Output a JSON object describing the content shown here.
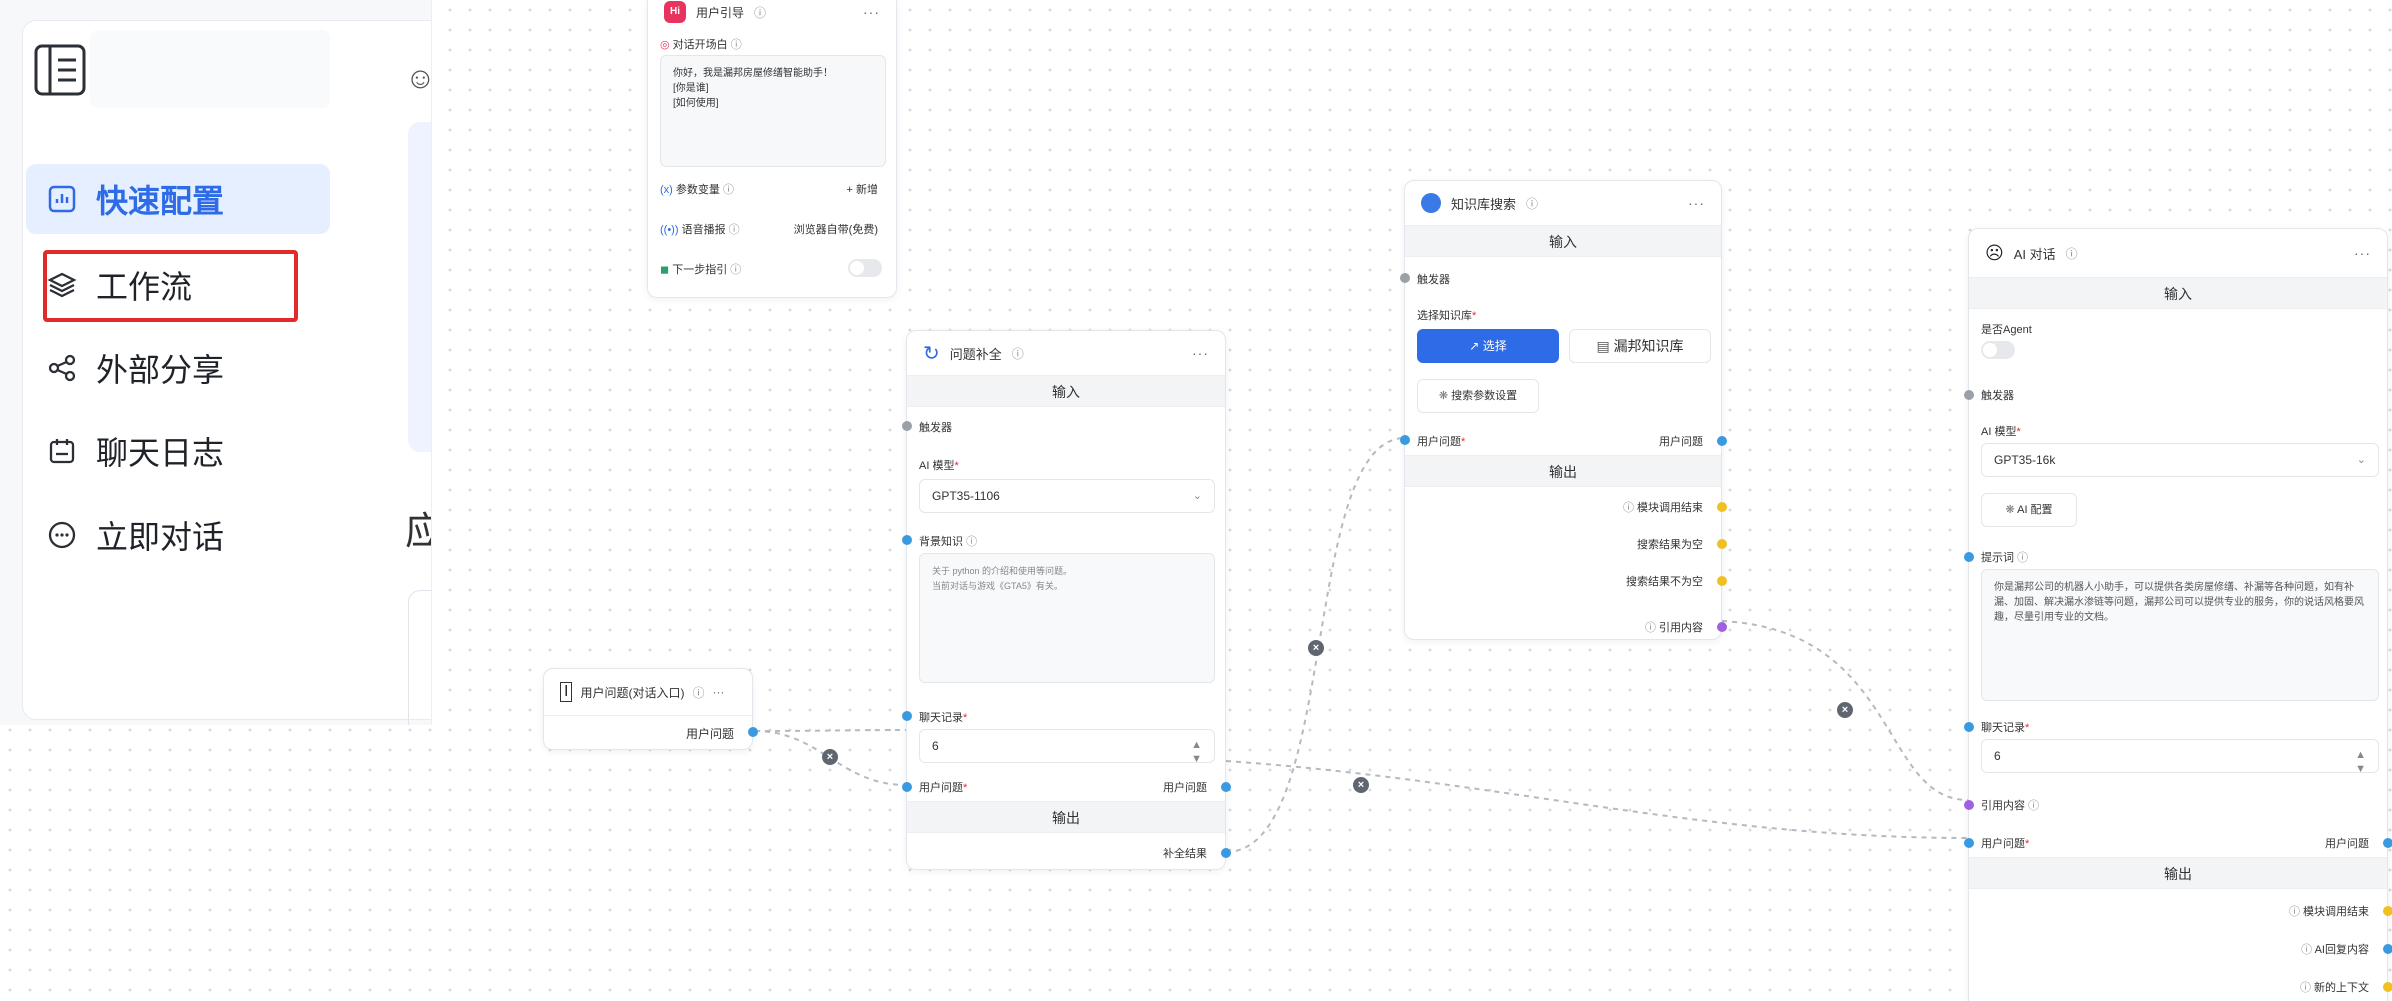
{
  "sidebar": {
    "items": [
      {
        "label": "快速配置",
        "icon": "bar-chart-icon",
        "active": true
      },
      {
        "label": "工作流",
        "icon": "layers-icon",
        "active": false
      },
      {
        "label": "外部分享",
        "icon": "share-icon",
        "active": false
      },
      {
        "label": "聊天日志",
        "icon": "calendar-icon",
        "active": false
      },
      {
        "label": "立即对话",
        "icon": "chat-bubble-icon",
        "active": false
      }
    ],
    "peek_char": "应"
  },
  "nodes": {
    "user_guide": {
      "badge": "Hi",
      "title": "用户引导",
      "opening_label": "对话开场白",
      "opening_text": "你好，我是漏邦房屋修缮智能助手！\n[你是谁]\n[如何使用]",
      "vars_label": "参数变量",
      "vars_action": "+ 新增",
      "voice_label": "语音播报",
      "voice_value": "浏览器自带(免费)",
      "next_label": "下一步指引"
    },
    "entry": {
      "title": "用户问题(对话入口)",
      "output_label": "用户问题"
    },
    "question_completion": {
      "title": "问题补全",
      "input_header": "输入",
      "trigger_label": "触发器",
      "model_label": "AI 模型",
      "model_value": "GPT35-1106",
      "background_label": "背景知识",
      "background_text": "关于 python 的介绍和使用等问题。\n当前对话与游戏《GTA5》有关。",
      "history_label": "聊天记录",
      "history_value": "6",
      "user_q_label": "用户问题",
      "user_q_right": "用户问题",
      "output_header": "输出",
      "output_label": "补全结果"
    },
    "kb_search": {
      "title": "知识库搜索",
      "input_header": "输入",
      "trigger_label": "触发器",
      "select_kb_label": "选择知识库",
      "select_button": "选择",
      "kb_name": "漏邦知识库",
      "search_params_button": "搜索参数设置",
      "user_q_label": "用户问题",
      "user_q_right": "用户问题",
      "output_header": "输出",
      "outputs": [
        "模块调用结束",
        "搜索结果为空",
        "搜索结果不为空",
        "引用内容"
      ]
    },
    "ai_chat": {
      "title": "AI 对话",
      "input_header": "输入",
      "agent_label": "是否Agent",
      "trigger_label": "触发器",
      "model_label": "AI 模型",
      "model_value": "GPT35-16k",
      "config_button": "AI 配置",
      "prompt_label": "提示词",
      "prompt_text": "你是漏邦公司的机器人小助手，可以提供各类房屋修缮、补漏等各种问题，如有补漏、加固、解决漏水渗链等问题，漏邦公司可以提供专业的服务，你的说话风格要风趣，尽量引用专业的文档。",
      "history_label": "聊天记录",
      "history_value": "6",
      "quote_label": "引用内容",
      "user_q_label": "用户问题",
      "user_q_right": "用户问题",
      "output_header": "输出",
      "outputs": [
        "模块调用结束",
        "AI回复内容",
        "新的上下文"
      ]
    }
  },
  "colors": {
    "accent": "#2e6be6",
    "highlight_outline": "#e22a2a",
    "handle_blue": "#3a9ae0",
    "handle_yellow": "#eec020",
    "handle_purple": "#a060e0"
  }
}
